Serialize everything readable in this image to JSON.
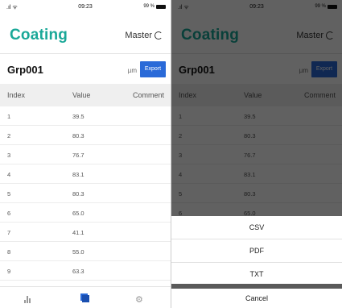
{
  "status": {
    "time": "09:23",
    "battery": "99 %"
  },
  "header": {
    "brand": "Coating",
    "mode": "Master"
  },
  "group": {
    "name": "Grp001",
    "unit": "µm",
    "export_label": "Export"
  },
  "table": {
    "columns": [
      "Index",
      "Value",
      "Comment"
    ],
    "rows": [
      {
        "index": "1",
        "value": "39.5",
        "comment": ""
      },
      {
        "index": "2",
        "value": "80.3",
        "comment": ""
      },
      {
        "index": "3",
        "value": "76.7",
        "comment": ""
      },
      {
        "index": "4",
        "value": "83.1",
        "comment": ""
      },
      {
        "index": "5",
        "value": "80.3",
        "comment": ""
      },
      {
        "index": "6",
        "value": "65.0",
        "comment": ""
      },
      {
        "index": "7",
        "value": "41.1",
        "comment": ""
      },
      {
        "index": "8",
        "value": "55.0",
        "comment": ""
      },
      {
        "index": "9",
        "value": "63.3",
        "comment": ""
      }
    ]
  },
  "tabbar": {
    "icons": [
      "bar-chart-icon",
      "layers-icon",
      "gear-icon"
    ]
  },
  "export_sheet": {
    "options": [
      "CSV",
      "PDF",
      "TXT"
    ],
    "cancel_label": "Cancel"
  },
  "colors": {
    "brand": "#1aa898",
    "accent": "#2a6ad8",
    "overlay": "rgba(0,0,0,0.62)"
  }
}
